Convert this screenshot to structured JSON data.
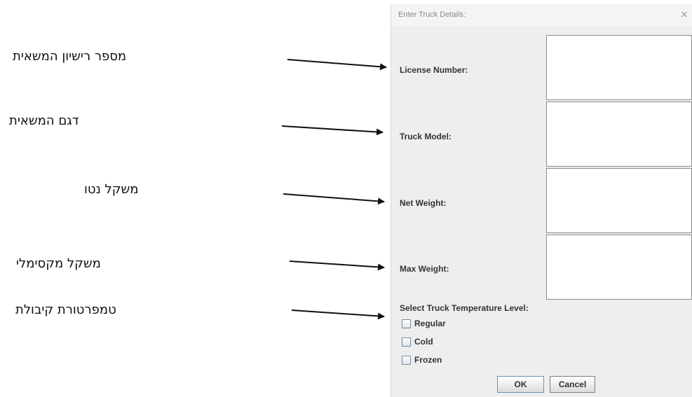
{
  "annotations": [
    "מספר רישיון המשאית",
    "דגם המשאית",
    "משקל נטו",
    "משקל מקסימלי",
    "טמפרטורת קיבולת"
  ],
  "dialog": {
    "title": "Enter Truck Details:",
    "close_icon": "×",
    "fields": [
      {
        "label": "License Number:",
        "value": ""
      },
      {
        "label": "Truck Model:",
        "value": ""
      },
      {
        "label": "Net Weight:",
        "value": ""
      },
      {
        "label": "Max Weight:",
        "value": ""
      }
    ],
    "temperature": {
      "label": "Select Truck Temperature Level:",
      "options": [
        {
          "label": "Regular",
          "checked": false
        },
        {
          "label": "Cold",
          "checked": false
        },
        {
          "label": "Frozen",
          "checked": false
        }
      ]
    },
    "buttons": {
      "ok": "OK",
      "cancel": "Cancel"
    }
  },
  "icons": {
    "close": "close-icon",
    "arrow": "arrow-right-icon",
    "checkbox": "checkbox-unchecked-icon"
  },
  "colors": {
    "dialog_background": "#eeeeee",
    "input_background": "#ffffff",
    "label_text": "#333333"
  }
}
